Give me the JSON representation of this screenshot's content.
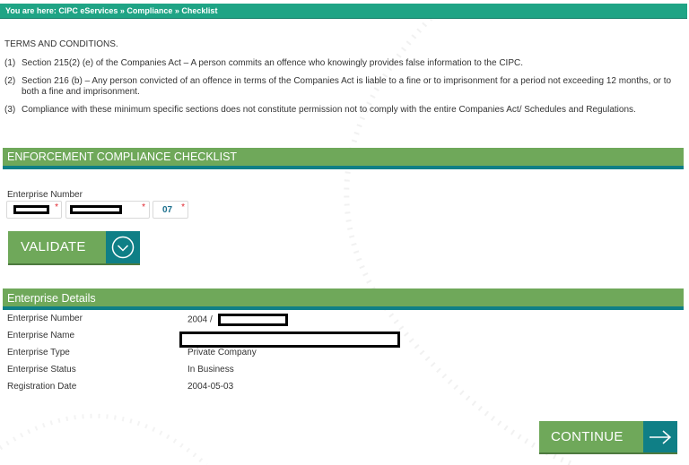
{
  "breadcrumb": "You are here: CIPC eServices » Compliance » Checklist",
  "terms": {
    "title": "TERMS AND CONDITIONS.",
    "items": [
      {
        "num": "(1)",
        "text": "Section 215(2) (e) of the Companies Act – A person commits an offence who knowingly provides false information to the CIPC."
      },
      {
        "num": "(2)",
        "text": "Section 216 (b) – Any person convicted of an offence in terms of the Companies Act is liable to a fine or to imprisonment for a period not exceeding 12 months, or to both a fine and imprisonment."
      },
      {
        "num": "(3)",
        "text": "Compliance with these minimum specific sections does not constitute permission not to comply with the entire Companies Act/ Schedules and Regulations."
      }
    ]
  },
  "enforcement": {
    "header": "ENFORCEMENT COMPLIANCE CHECKLIST",
    "enterprise_number_label": "Enterprise Number",
    "field3_value": "07",
    "required_marker": "*",
    "validate_label": "VALIDATE",
    "validate_icon": "check-circle-icon"
  },
  "details": {
    "header": "Enterprise Details",
    "rows": [
      {
        "label": "Enterprise Number",
        "value": "2004 /"
      },
      {
        "label": "Enterprise Name",
        "value": ""
      },
      {
        "label": "Enterprise Type",
        "value": "Private Company"
      },
      {
        "label": "Enterprise Status",
        "value": "In Business"
      },
      {
        "label": "Registration Date",
        "value": "2004-05-03"
      }
    ]
  },
  "continue_label": "CONTINUE",
  "continue_icon": "arrow-right-icon",
  "colors": {
    "breadcrumb_bg": "#1fa485",
    "section_bg": "#6fa85a",
    "accent_teal": "#0f7f86",
    "required_red": "#e0262e"
  }
}
